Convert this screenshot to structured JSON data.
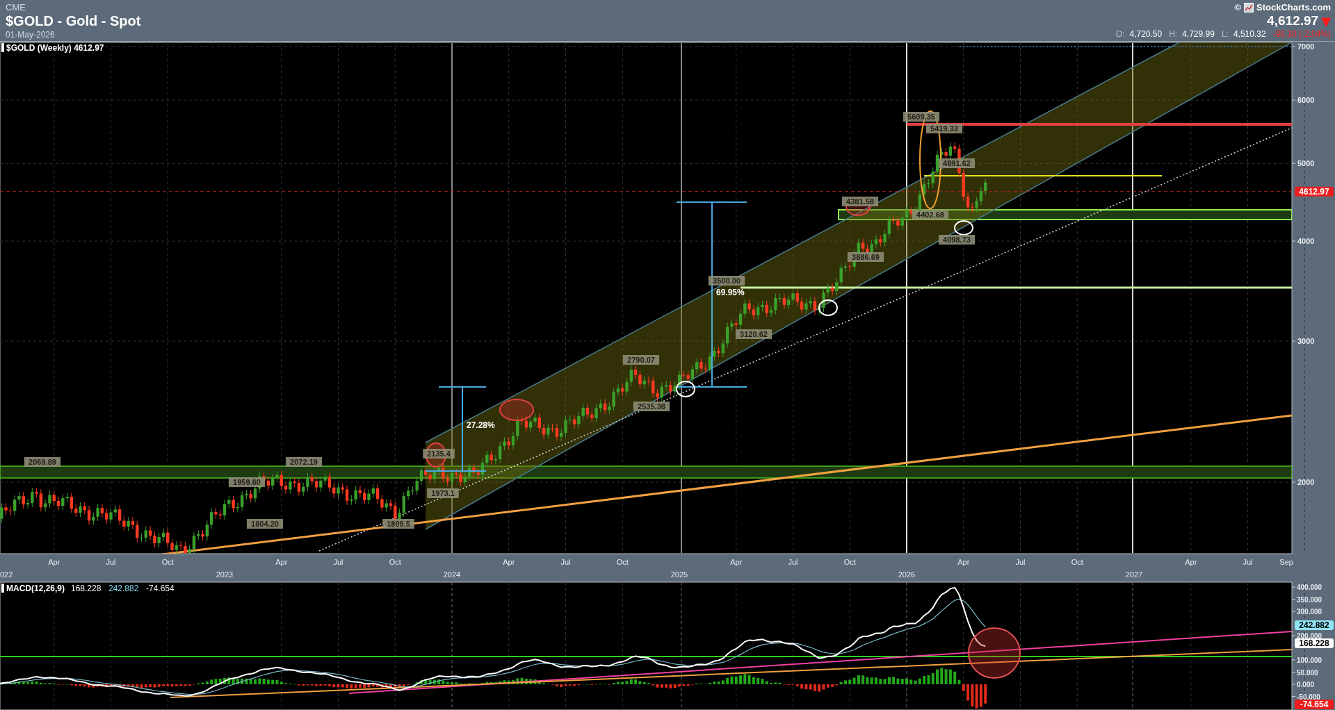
{
  "header": {
    "exchange": "CME",
    "title": "$GOLD - Gold - Spot",
    "date": "01-May-2026",
    "copyright_symbol": "©",
    "brand": "StockCharts.com",
    "last_price": "4,612.97",
    "change_arrow": "▼",
    "ohlc": [
      {
        "label": "O:",
        "value": "4,720.50"
      },
      {
        "label": "H:",
        "value": "4,729.99"
      },
      {
        "label": "L:",
        "value": "4,510.32"
      }
    ],
    "change": "-96.30 (-2.04%)"
  },
  "price_panel": {
    "legend": "$GOLD (Weekly) 4612.97",
    "y_ticks": [
      "7000",
      "6000",
      "5000",
      "4000",
      "3000",
      "2000"
    ],
    "current_price_tag": "4612.97",
    "annotations": [
      "5609.35",
      "5419.33",
      "4891.62",
      "4381.58",
      "4402.68",
      "4098.73",
      "3886.69",
      "3500.00",
      "3120.62",
      "2790.07",
      "2535.38",
      "2135.4",
      "2069.89",
      "2072.19",
      "1959.60",
      "1973.1",
      "1804.20",
      "1809.5"
    ],
    "measurements": [
      "27.28%",
      "69.95%"
    ]
  },
  "x_axis": {
    "months": [
      "Apr",
      "Jul",
      "Oct",
      "Apr",
      "Jul",
      "Oct",
      "Apr",
      "Jul",
      "Oct",
      "Apr",
      "Jul",
      "Oct",
      "Apr",
      "Jul",
      "Oct",
      "Apr",
      "Jul",
      "Sep"
    ],
    "years": [
      "022",
      "2023",
      "2024",
      "2025",
      "2026",
      "2027"
    ]
  },
  "macd_panel": {
    "legend": "MACD(12,26,9)",
    "macd": "168.228",
    "signal": "242.882",
    "histogram": "-74.654",
    "y_ticks": [
      "400.000",
      "350.000",
      "300.000",
      "200.000",
      "100.000",
      "50.000",
      "0.000",
      "-50.000"
    ],
    "axis_tags": [
      {
        "kind": "signal",
        "text": "242.882"
      },
      {
        "kind": "macd",
        "text": "168.228"
      },
      {
        "kind": "histogram",
        "text": "-74.654"
      }
    ]
  }
}
